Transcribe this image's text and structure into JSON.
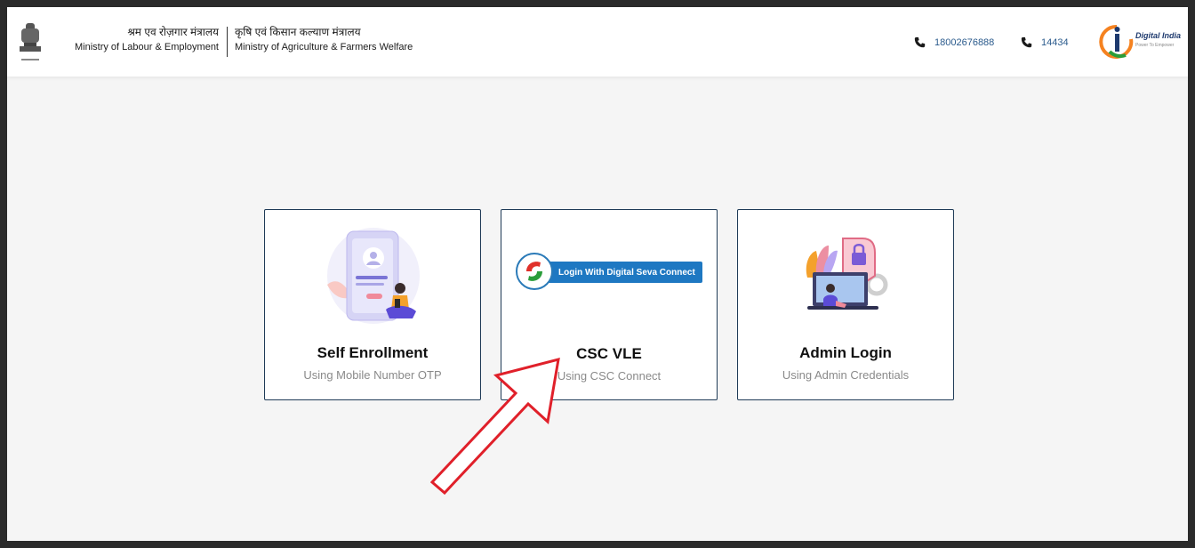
{
  "header": {
    "ministry_labour": {
      "hindi": "श्रम एव रोज़गार मंत्रालय",
      "english": "Ministry of Labour & Employment"
    },
    "ministry_agriculture": {
      "hindi": "कृषि एवं किसान कल्याण मंत्रालय",
      "english": "Ministry of Agriculture & Farmers Welfare"
    },
    "phones": [
      "18002676888",
      "14434"
    ],
    "logo": {
      "title": "Digital India",
      "tagline": "Power To Empower"
    }
  },
  "cards": [
    {
      "title": "Self Enrollment",
      "subtitle": "Using Mobile Number OTP"
    },
    {
      "title": "CSC VLE",
      "subtitle": "Using CSC Connect",
      "button_label": "Login With Digital Seva Connect"
    },
    {
      "title": "Admin Login",
      "subtitle": "Using Admin Credentials"
    }
  ],
  "colors": {
    "card_border": "#1f3b57",
    "phone_text": "#2a5a8c",
    "csc_blue": "#1e78c2",
    "annotation_arrow": "#e0202a"
  }
}
